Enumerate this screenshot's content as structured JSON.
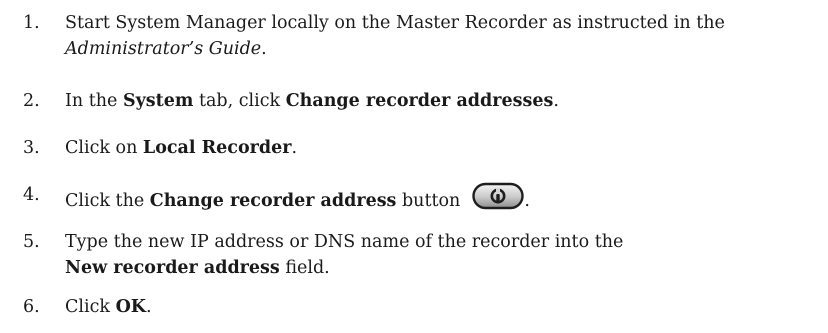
{
  "steps": [
    {
      "number": "1.",
      "part1": "Start System Manager locally on the Master Recorder as instructed in the",
      "part2_italic": "Administrator’s Guide",
      "part3": "."
    },
    {
      "number": "2.",
      "part1": "In the ",
      "bold1": "System",
      "part2": " tab, click ",
      "bold2": "Change recorder addresses",
      "part3": "."
    },
    {
      "number": "3.",
      "part1": "Click on ",
      "bold1": "Local Recorder",
      "part2": "."
    },
    {
      "number": "4.",
      "part1": "Click the ",
      "bold1": "Change recorder address",
      "part2": " button",
      "icon": "wrench-button-icon",
      "part3": "."
    },
    {
      "number": "5.",
      "part1": "Type the new IP address or DNS name of the recorder into the ",
      "bold1": "New recorder address",
      "part2": " field."
    },
    {
      "number": "6.",
      "part1": "Click ",
      "bold1": "OK",
      "part2": "."
    }
  ]
}
